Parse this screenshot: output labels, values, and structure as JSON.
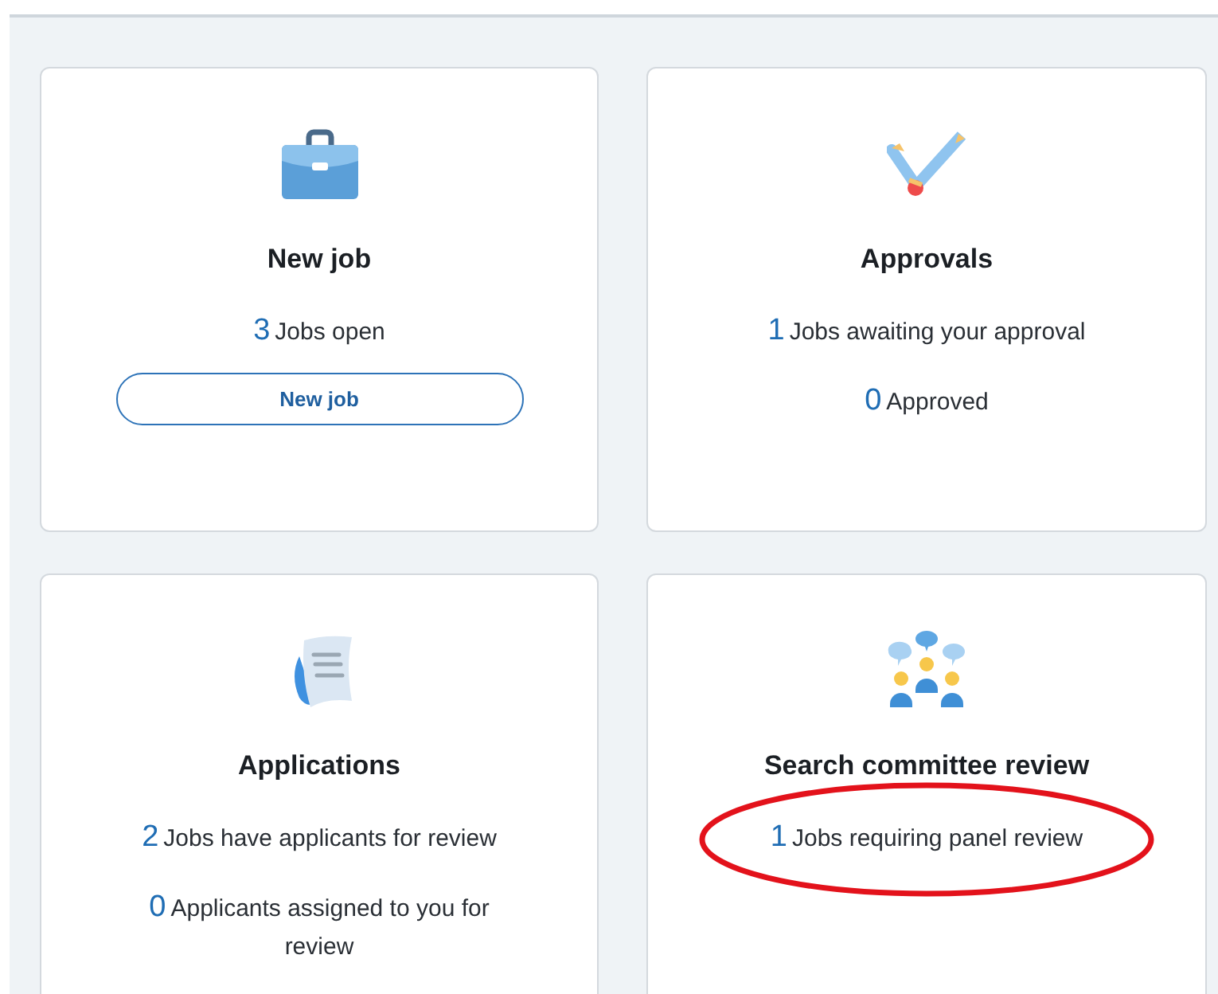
{
  "cards": [
    {
      "kind": "briefcase",
      "title": "New job",
      "stats": [
        {
          "count": "3",
          "label": "Jobs open",
          "circled": false
        }
      ],
      "button": "New job"
    },
    {
      "kind": "pencils",
      "title": "Approvals",
      "stats": [
        {
          "count": "1",
          "label": "Jobs awaiting your approval",
          "circled": false
        },
        {
          "count": "0",
          "label": "Approved",
          "circled": false
        }
      ]
    },
    {
      "kind": "document",
      "title": "Applications",
      "stats": [
        {
          "count": "2",
          "label": "Jobs have applicants for review",
          "circled": false
        },
        {
          "count": "0",
          "label": "Applicants assigned to you for review",
          "circled": false
        }
      ]
    },
    {
      "kind": "people",
      "title": "Search committee review",
      "stats": [
        {
          "count": "1",
          "label": "Jobs requiring panel review",
          "circled": true
        }
      ]
    }
  ]
}
